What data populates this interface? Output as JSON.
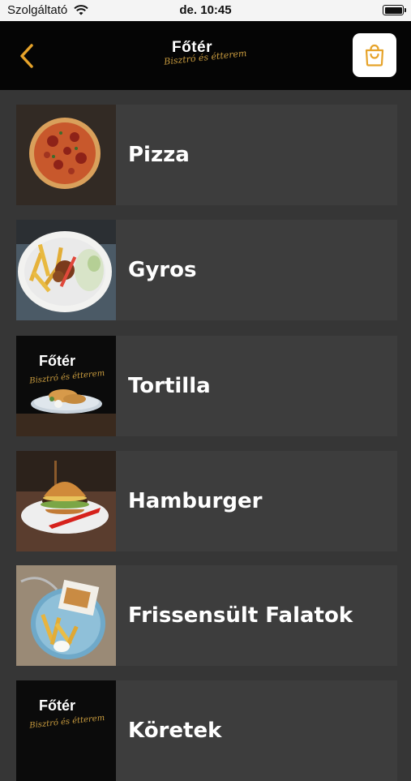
{
  "status_bar": {
    "carrier": "Szolgáltató",
    "time": "de. 10:45"
  },
  "header": {
    "logo_title": "Főtér",
    "logo_subtitle": "Bisztró és étterem"
  },
  "colors": {
    "accent": "#e6a32a",
    "background": "#363636",
    "card": "#3d3d3d",
    "header": "#050505"
  },
  "categories": [
    {
      "label": "Pizza",
      "image": "pizza-photo"
    },
    {
      "label": "Gyros",
      "image": "gyros-plate-photo"
    },
    {
      "label": "Tortilla",
      "image": "fooder-logo-plate-photo"
    },
    {
      "label": "Hamburger",
      "image": "burger-photo"
    },
    {
      "label": "Frissensült Falatok",
      "image": "fried-plate-photo"
    },
    {
      "label": "Köretek",
      "image": "fooder-logo-photo"
    }
  ]
}
